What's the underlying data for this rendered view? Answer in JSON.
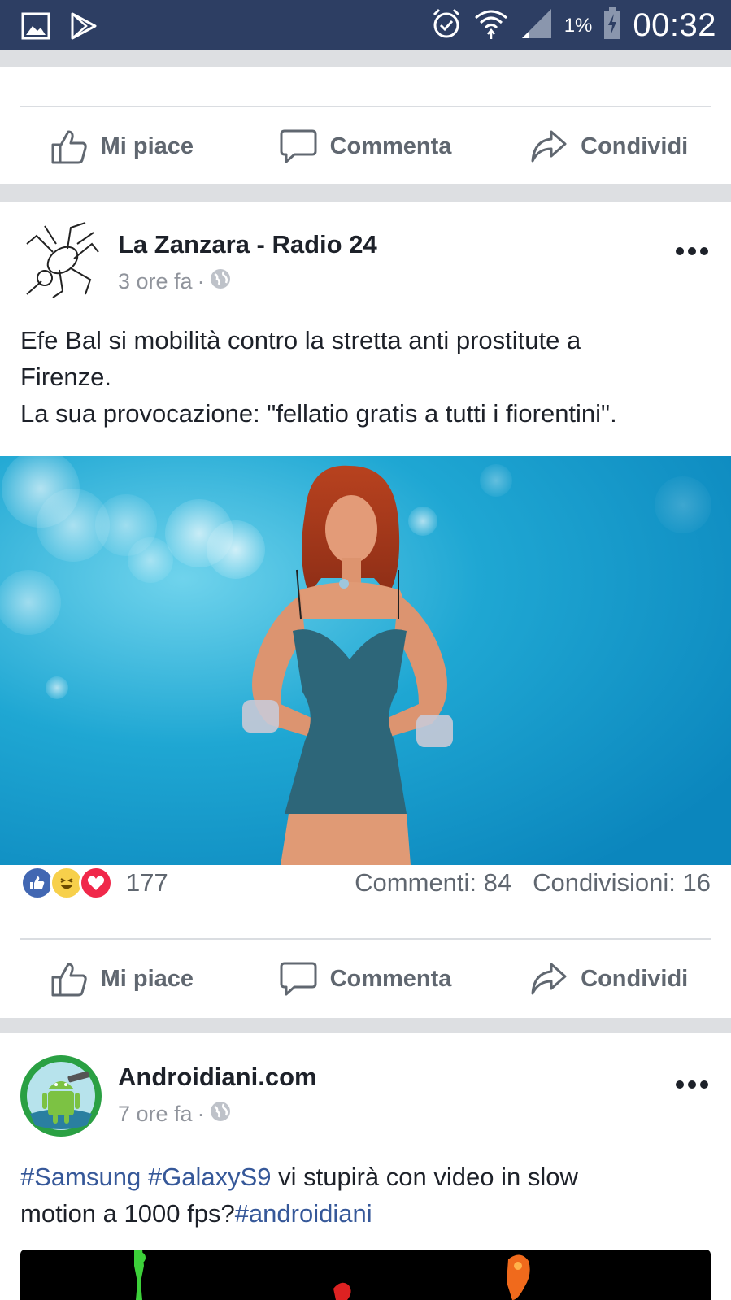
{
  "status_bar": {
    "battery_percent": "1%",
    "time": "00:32"
  },
  "actions": {
    "like": "Mi piace",
    "comment": "Commenta",
    "share": "Condividi"
  },
  "posts": [
    {
      "page_name": "La Zanzara - Radio 24",
      "time": "3 ore fa",
      "separator": "·",
      "text_line1": "Efe Bal si mobilità contro la stretta anti prostitute a",
      "text_line2": "Firenze.",
      "text_line3": "La sua provocazione: \"fellatio gratis a tutti i fiorentini\".",
      "reaction_count": "177",
      "comments": "Commenti: 84",
      "shares": "Condivisioni: 16"
    },
    {
      "page_name": "Androidiani.com",
      "time": "7 ore fa",
      "separator": "·",
      "hashtag1": "#Samsung",
      "hashtag2": "#GalaxyS9",
      "text_part1": " vi stupirà con video in slow",
      "text_part2": "motion a 1000 fps?",
      "hashtag3": "#androidiani"
    }
  ],
  "colors": {
    "status_bar": "#2d3e63",
    "like_blue": "#4267b2",
    "love_red": "#f0284a",
    "haha_yellow": "#f7d04b",
    "hashtag": "#365899",
    "photo_bg": "#1aa3d1"
  },
  "icons": [
    "gallery-icon",
    "play-store-icon",
    "alarm-icon",
    "wifi-icon",
    "signal-icon",
    "battery-charging-icon",
    "thumb-up-icon",
    "comment-icon",
    "share-icon",
    "globe-icon",
    "more-icon"
  ]
}
